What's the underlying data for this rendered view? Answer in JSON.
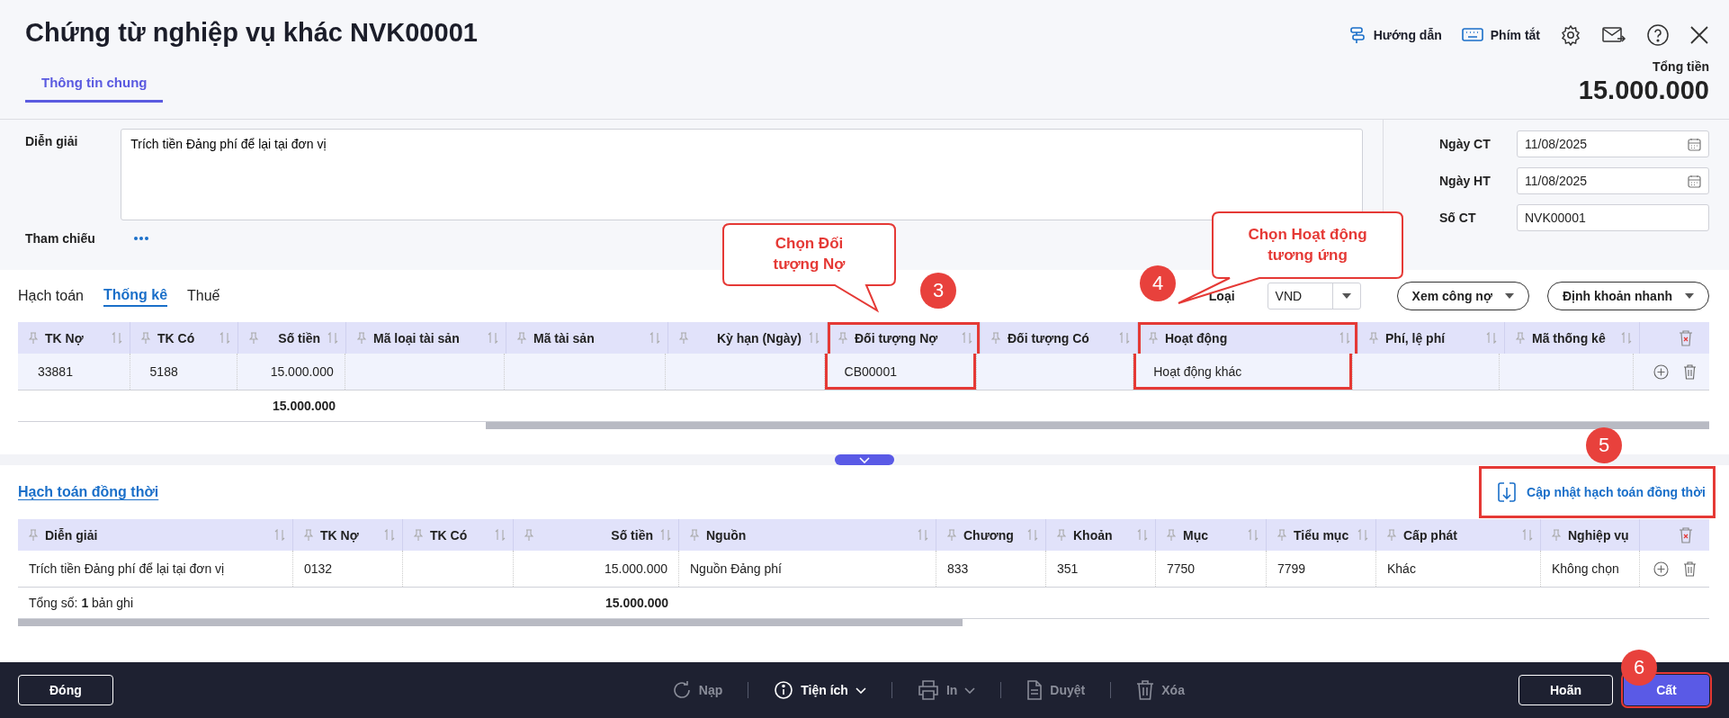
{
  "header": {
    "title": "Chứng từ nghiệp vụ khác NVK00001",
    "guide_link": "Hướng dẫn",
    "shortcut_link": "Phím tắt"
  },
  "total": {
    "label": "Tổng tiền",
    "value": "15.000.000"
  },
  "tabs": [
    {
      "label": "Thông tin chung",
      "selected": true
    }
  ],
  "form": {
    "description": {
      "label": "Diễn giải",
      "value": "Trích tiền Đảng phí để lại tại đơn vị"
    },
    "reference": {
      "label": "Tham chiếu"
    }
  },
  "fields": [
    {
      "label": "Ngày CT",
      "value": "11/08/2025",
      "kind": "date"
    },
    {
      "label": "Ngày HT",
      "value": "11/08/2025",
      "kind": "date"
    },
    {
      "label": "Số CT",
      "value": "NVK00001",
      "kind": "text"
    }
  ],
  "detail_tabs": [
    {
      "label": "Hạch toán",
      "selected": false
    },
    {
      "label": "Thống kê",
      "selected": true
    },
    {
      "label": "Thuế",
      "selected": false
    }
  ],
  "currency": {
    "label": "Loại",
    "value": "VND"
  },
  "toolbar_buttons": [
    "Xem công nợ",
    "Định khoản nhanh"
  ],
  "grid": {
    "columns": [
      {
        "label": "TK Nợ",
        "kind": "text",
        "highlighted": false,
        "values": [
          "33881"
        ]
      },
      {
        "label": "TK Có",
        "kind": "text",
        "highlighted": false,
        "values": [
          "5188"
        ]
      },
      {
        "label": "Số tiền",
        "kind": "amount",
        "highlighted": false,
        "values": [
          "15.000.000"
        ],
        "total": "15.000.000"
      },
      {
        "label": "Mã loại tài sản",
        "kind": "text",
        "highlighted": false
      },
      {
        "label": "Mã tài sản",
        "kind": "text",
        "highlighted": false
      },
      {
        "label": "Kỳ hạn (Ngày)",
        "kind": "amount",
        "highlighted": false
      },
      {
        "label": "Đối tượng Nợ",
        "kind": "text",
        "highlighted": true,
        "values": [
          "CB00001"
        ]
      },
      {
        "label": "Đối tượng Có",
        "kind": "text",
        "highlighted": false
      },
      {
        "label": "Hoạt động",
        "kind": "text",
        "highlighted": true,
        "values": [
          "Hoạt động khác"
        ]
      },
      {
        "label": "Phí, lệ phí",
        "kind": "text",
        "highlighted": false
      },
      {
        "label": "Mã thống kê",
        "kind": "text",
        "highlighted": false
      }
    ]
  },
  "concurrent": {
    "title": "Hạch toán đồng thời",
    "update_button": {
      "label": "Cập nhật hạch toán đồng thời",
      "highlighted": true,
      "step": "5"
    },
    "columns": [
      {
        "label": "Diễn giải",
        "kind": "text",
        "values": [
          "Trích tiền Đảng phí để lại tại đơn vị"
        ]
      },
      {
        "label": "TK Nợ",
        "kind": "text",
        "values": [
          "0132"
        ]
      },
      {
        "label": "TK Có",
        "kind": "text"
      },
      {
        "label": "Số tiền",
        "kind": "amount",
        "values": [
          "15.000.000"
        ],
        "total": "15.000.000"
      },
      {
        "label": "Nguồn",
        "kind": "text",
        "values": [
          "Nguồn Đảng phí"
        ]
      },
      {
        "label": "Chương",
        "kind": "text",
        "values": [
          "833"
        ]
      },
      {
        "label": "Khoản",
        "kind": "text",
        "values": [
          "351"
        ]
      },
      {
        "label": "Mục",
        "kind": "text",
        "values": [
          "7750"
        ]
      },
      {
        "label": "Tiểu mục",
        "kind": "text",
        "values": [
          "7799"
        ]
      },
      {
        "label": "Cấp phát",
        "kind": "text",
        "values": [
          "Khác"
        ]
      },
      {
        "label": "Nghiệp vụ",
        "kind": "text",
        "values": [
          "Không chọn"
        ]
      }
    ],
    "record_count": "Tổng số: **1** bản ghi"
  },
  "callouts": [
    {
      "text": "Chọn Đối tượng Nợ",
      "step": "3"
    },
    {
      "text": "Chọn Hoạt động tương ứng",
      "step": "4"
    }
  ],
  "footer": {
    "close": "Đóng",
    "actions": [
      {
        "label": "Nạp",
        "kind": "reload",
        "disabled": true
      },
      {
        "label": "Tiện ích",
        "kind": "utility",
        "disabled": false
      },
      {
        "label": "In",
        "kind": "print",
        "disabled": true
      },
      {
        "label": "Duyệt",
        "kind": "approve",
        "disabled": true
      },
      {
        "label": "Xóa",
        "kind": "delete",
        "disabled": true
      }
    ],
    "defer": "Hoãn",
    "save": {
      "label": "Cất",
      "highlighted": true,
      "step": "6"
    }
  }
}
